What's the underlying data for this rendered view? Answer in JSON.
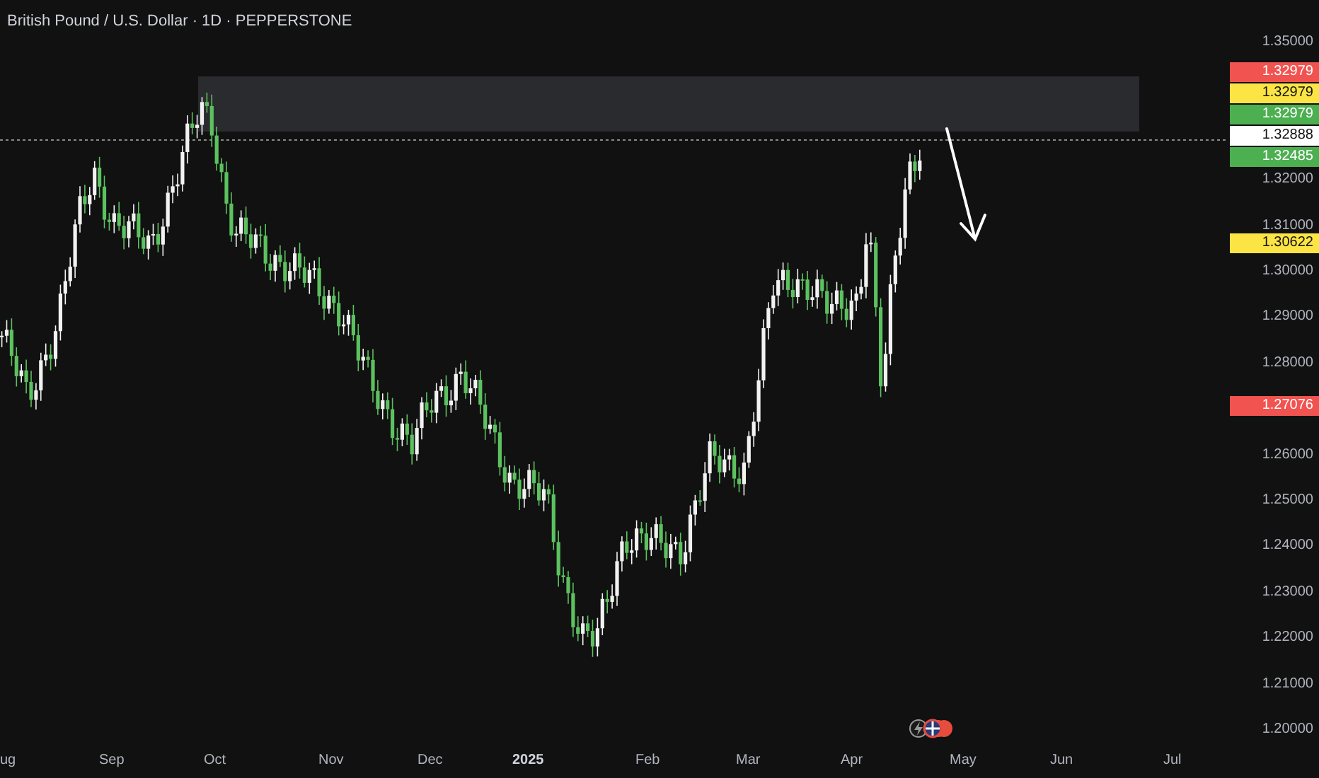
{
  "chart_title": "British Pound / U.S. Dollar · 1D · PEPPERSTONE",
  "price_axis": {
    "ticks": [
      "1.35000",
      "1.32000",
      "1.31000",
      "1.30000",
      "1.29000",
      "1.28000",
      "1.26000",
      "1.25000",
      "1.24000",
      "1.23000",
      "1.22000",
      "1.21000",
      "1.20000"
    ],
    "badges": [
      {
        "value": "1.32979",
        "color": "#f05350"
      },
      {
        "value": "1.32979",
        "color": "#fbe443"
      },
      {
        "value": "1.32979",
        "color": "#4caf50"
      },
      {
        "value": "1.32888",
        "color": "#ffffff"
      },
      {
        "value": "1.32485",
        "color": "#4caf50"
      },
      {
        "value": "1.30622",
        "color": "#fbe443"
      },
      {
        "value": "1.27076",
        "color": "#f05350"
      }
    ]
  },
  "time_axis": [
    {
      "label": "ug",
      "kind": "month"
    },
    {
      "label": "Sep",
      "kind": "month"
    },
    {
      "label": "Oct",
      "kind": "month"
    },
    {
      "label": "Nov",
      "kind": "month"
    },
    {
      "label": "Dec",
      "kind": "month"
    },
    {
      "label": "2025",
      "kind": "year"
    },
    {
      "label": "Feb",
      "kind": "month"
    },
    {
      "label": "Mar",
      "kind": "month"
    },
    {
      "label": "Apr",
      "kind": "month"
    },
    {
      "label": "May",
      "kind": "month"
    },
    {
      "label": "Jun",
      "kind": "month"
    },
    {
      "label": "Jul",
      "kind": "month"
    }
  ]
}
